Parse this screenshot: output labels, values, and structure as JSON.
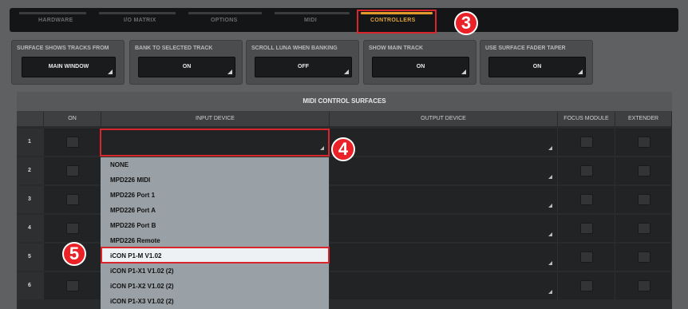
{
  "tabs": [
    {
      "label": "HARDWARE"
    },
    {
      "label": "I/O MATRIX"
    },
    {
      "label": "OPTIONS"
    },
    {
      "label": "MIDI"
    },
    {
      "label": "CONTROLLERS",
      "active": true
    }
  ],
  "options": [
    {
      "label": "SURFACE SHOWS TRACKS FROM",
      "value": "MAIN WINDOW"
    },
    {
      "label": "BANK TO SELECTED TRACK",
      "value": "ON"
    },
    {
      "label": "SCROLL LUNA WHEN BANKING",
      "value": "OFF"
    },
    {
      "label": "SHOW MAIN TRACK",
      "value": "ON"
    },
    {
      "label": "USE SURFACE FADER TAPER",
      "value": "ON"
    }
  ],
  "midi_panel": {
    "title": "MIDI CONTROL SURFACES",
    "columns": [
      "ON",
      "INPUT DEVICE",
      "OUTPUT DEVICE",
      "FOCUS MODULE",
      "EXTENDER"
    ],
    "rows": [
      "1",
      "2",
      "3",
      "4",
      "5",
      "6"
    ]
  },
  "dropdown": {
    "items": [
      "NONE",
      "MPD226 MIDI",
      "MPD226 Port 1",
      "MPD226 Port A",
      "MPD226 Port B",
      "MPD226 Remote",
      "iCON P1-M V1.02",
      "iCON P1-X1 V1.02 (2)",
      "iCON P1-X2 V1.02 (2)",
      "iCON P1-X3 V1.02 (2)"
    ],
    "selected": "iCON P1-M V1.02"
  },
  "callouts": [
    "3",
    "4",
    "5"
  ],
  "colors": {
    "accent": "#e29b2a",
    "callout": "#ea2227",
    "background": "#5e6062"
  }
}
